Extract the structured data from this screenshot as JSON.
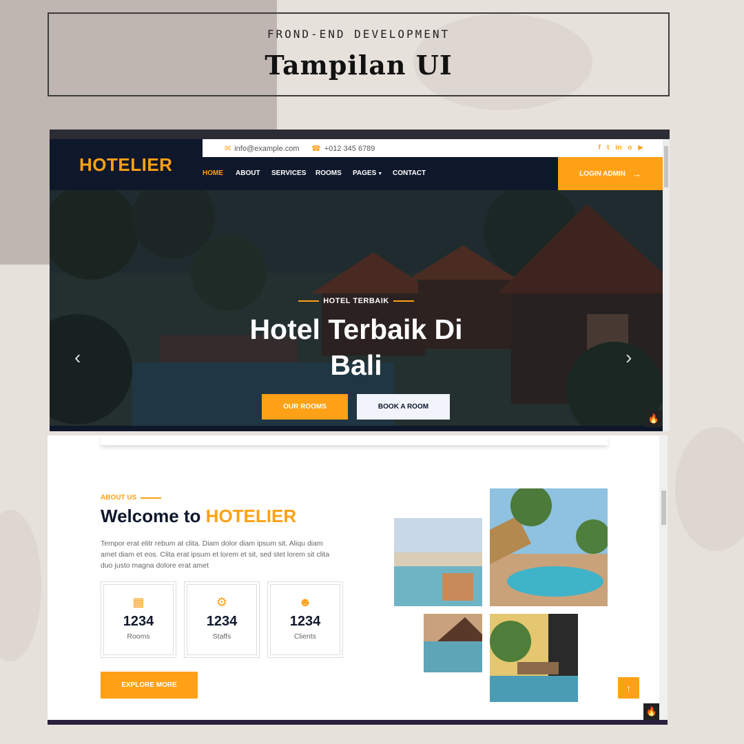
{
  "header": {
    "subtitle": "FROND-END DEVELOPMENT",
    "title": "Tampilan UI"
  },
  "site": {
    "brand": "HOTELIER",
    "email": "info@example.com",
    "phone": "+012 345 6789",
    "social": [
      "f",
      "t",
      "in",
      "o",
      "▶"
    ],
    "nav": [
      "HOME",
      "ABOUT",
      "SERVICES",
      "ROOMS",
      "PAGES",
      "CONTACT"
    ],
    "login": "LOGIN ADMIN"
  },
  "hero": {
    "kicker": "HOTEL TERBAIK",
    "title_line1": "Hotel Terbaik Di",
    "title_line2": "Bali",
    "btn_rooms": "OUR ROOMS",
    "btn_book": "BOOK A ROOM"
  },
  "about": {
    "kicker": "ABOUT US",
    "title_prefix": "Welcome to ",
    "title_brand": "HOTELIER",
    "text": "Tempor erat elitr rebum at clita. Diam dolor diam ipsum sit. Aliqu diam amet diam et eos. Clita erat ipsum et lorem et sit, sed stet lorem sit clita duo justo magna dolore erat amet",
    "stats": [
      {
        "value": "1234",
        "label": "Rooms",
        "icon": "hotel-icon"
      },
      {
        "value": "1234",
        "label": "Staffs",
        "icon": "users-cog-icon"
      },
      {
        "value": "1234",
        "label": "Clients",
        "icon": "users-icon"
      }
    ],
    "explore": "EXPLORE MORE"
  },
  "colors": {
    "accent": "#fea116",
    "dark": "#0f172b"
  }
}
